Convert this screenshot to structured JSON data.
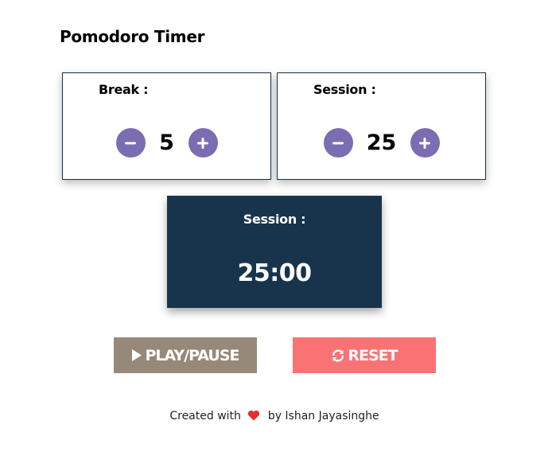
{
  "app": {
    "title": "Pomodoro Timer"
  },
  "break": {
    "label": "Break :",
    "value": "5",
    "decrement_icon": "minus-icon",
    "increment_icon": "plus-icon"
  },
  "session": {
    "label": "Session :",
    "value": "25",
    "decrement_icon": "minus-icon",
    "increment_icon": "plus-icon"
  },
  "timer": {
    "label": "Session :",
    "time": "25:00"
  },
  "buttons": {
    "play_pause": {
      "label": "PLAY/PAUSE",
      "icon": "play-icon"
    },
    "reset": {
      "label": "RESET",
      "icon": "refresh-icon"
    }
  },
  "footer": {
    "prefix": "Created with",
    "heart_icon": "heart-icon",
    "suffix": "by Ishan Jayasinghe"
  },
  "colors": {
    "accent_purple": "#7a6db1",
    "display_navy": "#17344c",
    "play_button": "#968979",
    "reset_button": "#f97375",
    "heart": "#e62e2e"
  }
}
